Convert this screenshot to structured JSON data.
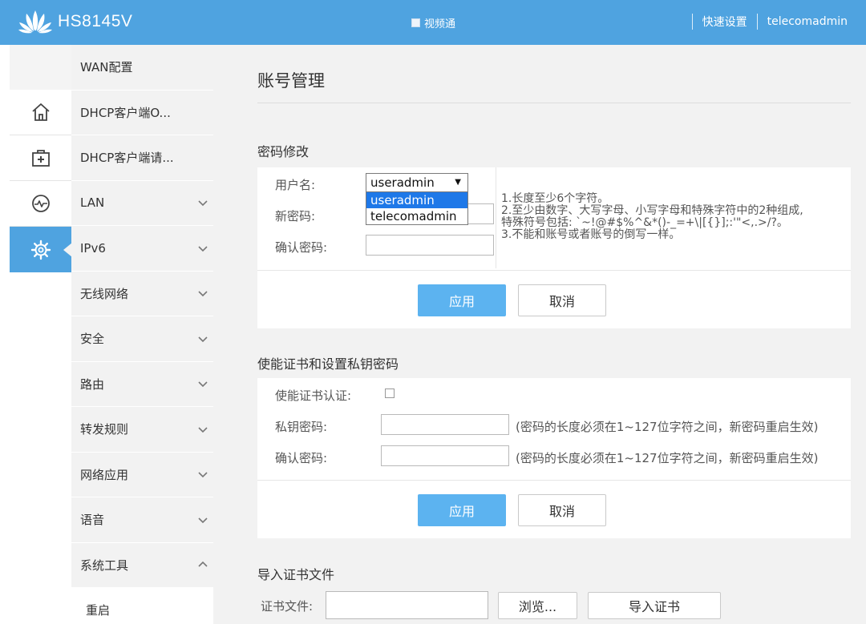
{
  "header": {
    "brand_name": "HS8145V",
    "video_label": "视频通",
    "quick_setup": "快速设置",
    "username": "telecomadmin",
    "bg_color": "#4fa3e0"
  },
  "rail": {
    "items": [
      {
        "icon": "home-icon",
        "active": false
      },
      {
        "icon": "first-aid-kit-icon",
        "active": false
      },
      {
        "icon": "heartbeat-gauge-icon",
        "active": false
      },
      {
        "icon": "gear-icon",
        "active": true
      }
    ]
  },
  "submenu": {
    "items": [
      {
        "label": "WAN配置"
      },
      {
        "label": "DHCP客户端O..."
      },
      {
        "label": "DHCP客户端请..."
      },
      {
        "label": "LAN",
        "chevron": "down"
      },
      {
        "label": "IPv6",
        "chevron": "down"
      },
      {
        "label": "无线网络",
        "chevron": "down"
      },
      {
        "label": "安全",
        "chevron": "down"
      },
      {
        "label": "路由",
        "chevron": "down"
      },
      {
        "label": "转发规则",
        "chevron": "down"
      },
      {
        "label": "网络应用",
        "chevron": "down"
      },
      {
        "label": "语音",
        "chevron": "down"
      },
      {
        "label": "系统工具",
        "chevron": "up"
      },
      {
        "label": "重启"
      }
    ]
  },
  "main": {
    "page_title": "账号管理",
    "password_section": {
      "title": "密码修改",
      "username_label": "用户名:",
      "new_password_label": "新密码:",
      "confirm_password_label": "确认密码:",
      "selected_user": "useradmin",
      "options": [
        "useradmin",
        "telecomadmin"
      ],
      "rules": [
        "1.长度至少6个字符。",
        "2.至少由数字、大写字母、小写字母和特殊字符中的2种组成,",
        "特殊符号包括: `~!@#$%^&*()-_=+\\|[{}];:'\"<,.>/?。",
        "3.不能和账号或者账号的倒写一样。"
      ],
      "apply": "应用",
      "cancel": "取消"
    },
    "cert_section": {
      "title": "使能证书和设置私钥密码",
      "enable_label": "使能证书认证:",
      "private_key_label": "私钥密码:",
      "confirm_label": "确认密码:",
      "hint": "(密码的长度必须在1~127位字符之间，新密码重启生效)",
      "apply": "应用",
      "cancel": "取消"
    },
    "import_section": {
      "title": "导入证书文件",
      "file_label": "证书文件:",
      "browse": "浏览...",
      "import": "导入证书"
    }
  }
}
